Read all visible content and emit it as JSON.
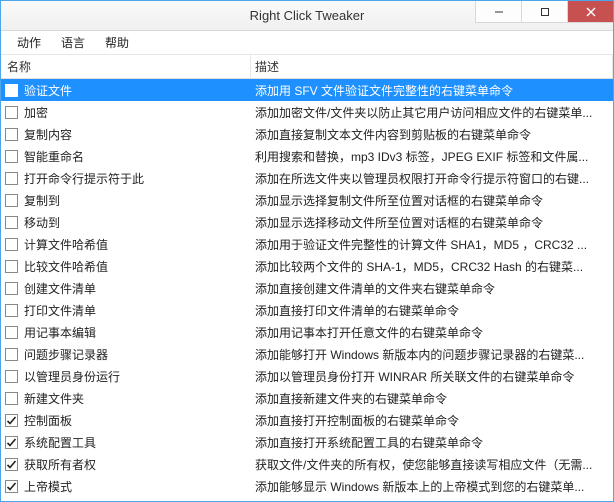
{
  "window": {
    "title": "Right Click Tweaker"
  },
  "menu": {
    "items": [
      {
        "label": "动作"
      },
      {
        "label": "语言"
      },
      {
        "label": "帮助"
      }
    ]
  },
  "columns": {
    "name": "名称",
    "description": "描述"
  },
  "rows": [
    {
      "checked": false,
      "selected": true,
      "name": "验证文件",
      "desc": "添加用 SFV 文件验证文件完整性的右键菜单命令"
    },
    {
      "checked": false,
      "selected": false,
      "name": "加密",
      "desc": "添加加密文件/文件夹以防止其它用户访问相应文件的右键菜单..."
    },
    {
      "checked": false,
      "selected": false,
      "name": "复制内容",
      "desc": "添加直接复制文本文件内容到剪贴板的右键菜单命令"
    },
    {
      "checked": false,
      "selected": false,
      "name": "智能重命名",
      "desc": "利用搜索和替换，mp3 IDv3 标签，JPEG EXIF 标签和文件属..."
    },
    {
      "checked": false,
      "selected": false,
      "name": "打开命令行提示符于此",
      "desc": "添加在所选文件夹以管理员权限打开命令行提示符窗口的右键..."
    },
    {
      "checked": false,
      "selected": false,
      "name": "复制到",
      "desc": "添加显示选择复制文件所至位置对话框的右键菜单命令"
    },
    {
      "checked": false,
      "selected": false,
      "name": "移动到",
      "desc": "添加显示选择移动文件所至位置对话框的右键菜单命令"
    },
    {
      "checked": false,
      "selected": false,
      "name": "计算文件哈希值",
      "desc": "添加用于验证文件完整性的计算文件 SHA1，MD5 ，CRC32 ..."
    },
    {
      "checked": false,
      "selected": false,
      "name": "比较文件哈希值",
      "desc": "添加比较两个文件的 SHA-1，MD5，CRC32 Hash 的右键菜..."
    },
    {
      "checked": false,
      "selected": false,
      "name": "创建文件清单",
      "desc": "添加直接创建文件清单的文件夹右键菜单命令"
    },
    {
      "checked": false,
      "selected": false,
      "name": "打印文件清单",
      "desc": "添加直接打印文件清单的右键菜单命令"
    },
    {
      "checked": false,
      "selected": false,
      "name": "用记事本编辑",
      "desc": "添加用记事本打开任意文件的右键菜单命令"
    },
    {
      "checked": false,
      "selected": false,
      "name": "问题步骤记录器",
      "desc": "添加能够打开 Windows 新版本内的问题步骤记录器的右键菜..."
    },
    {
      "checked": false,
      "selected": false,
      "name": "以管理员身份运行",
      "desc": "添加以管理员身份打开 WINRAR 所关联文件的右键菜单命令"
    },
    {
      "checked": false,
      "selected": false,
      "name": "新建文件夹",
      "desc": "添加直接新建文件夹的右键菜单命令"
    },
    {
      "checked": true,
      "selected": false,
      "name": "控制面板",
      "desc": "添加直接打开控制面板的右键菜单命令"
    },
    {
      "checked": true,
      "selected": false,
      "name": "系统配置工具",
      "desc": "添加直接打开系统配置工具的右键菜单命令"
    },
    {
      "checked": true,
      "selected": false,
      "name": "获取所有者权",
      "desc": "获取文件/文件夹的所有权，使您能够直接读写相应文件（无需..."
    },
    {
      "checked": true,
      "selected": false,
      "name": "上帝模式",
      "desc": "添加能够显示 Windows 新版本上的上帝模式到您的右键菜单..."
    }
  ]
}
